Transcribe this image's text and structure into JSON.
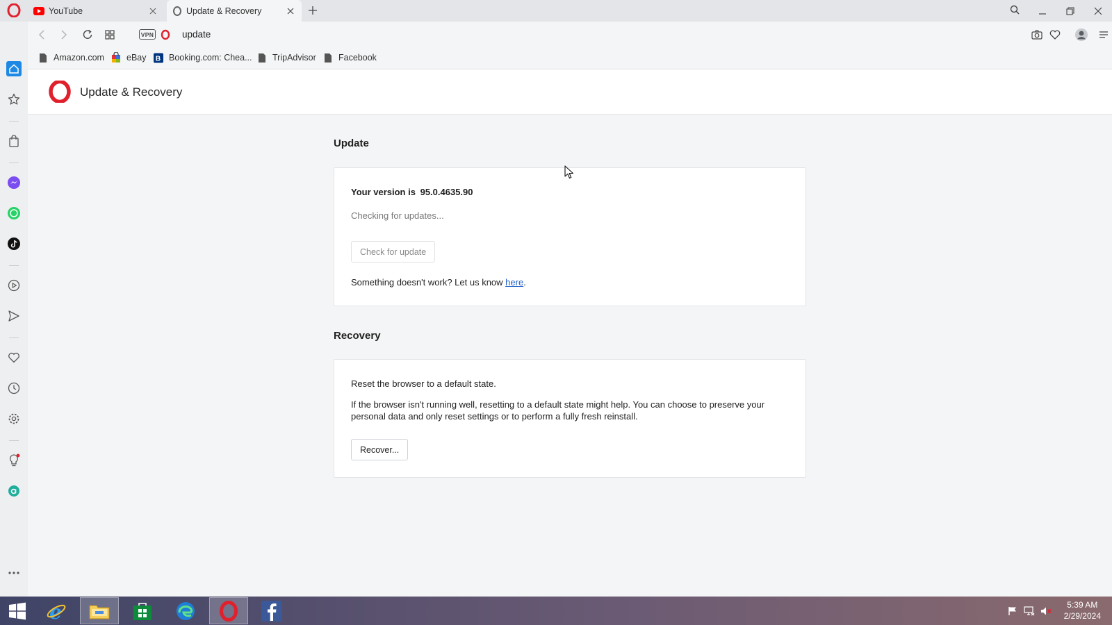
{
  "tabs": [
    {
      "title": "YouTube",
      "icon": "youtube-icon",
      "active": false
    },
    {
      "title": "Update & Recovery",
      "icon": "opera-icon",
      "active": true
    }
  ],
  "toolbar": {
    "vpn_label": "VPN",
    "address": "update"
  },
  "bookmarks": [
    {
      "label": "Amazon.com",
      "icon": "page-icon"
    },
    {
      "label": "eBay",
      "icon": "ebay-bag-icon"
    },
    {
      "label": "Booking.com: Chea...",
      "icon": "booking-icon"
    },
    {
      "label": "TripAdvisor",
      "icon": "page-icon"
    },
    {
      "label": "Facebook",
      "icon": "page-icon"
    }
  ],
  "sidebar": {
    "items": [
      "home-icon",
      "speed-dial-icon",
      "shopping-bag-icon",
      "messenger-icon",
      "whatsapp-icon",
      "tiktok-icon",
      "player-icon",
      "send-icon",
      "heart-icon",
      "history-icon",
      "settings-icon",
      "lightbulb-icon",
      "aria-icon",
      "more-icon"
    ]
  },
  "page": {
    "title": "Update & Recovery"
  },
  "update": {
    "heading": "Update",
    "version_label": "Your version is",
    "version": "95.0.4635.90",
    "status": "Checking for updates...",
    "check_button": "Check for update",
    "feedback_text": "Something doesn't work? Let us know ",
    "feedback_link": "here",
    "feedback_end": "."
  },
  "recovery": {
    "heading": "Recovery",
    "reset_line": "Reset the browser to a default state.",
    "description": "If the browser isn't running well, resetting to a default state might help. You can choose to preserve your personal data and only reset settings or to perform a fully fresh reinstall.",
    "recover_button": "Recover..."
  },
  "taskbar": {
    "apps": [
      "start-icon",
      "internet-explorer-icon",
      "file-explorer-icon",
      "store-icon",
      "edge-icon",
      "opera-icon",
      "facebook-icon"
    ],
    "time": "5:39 AM",
    "date": "2/29/2024"
  },
  "colors": {
    "opera_red": "#e0202c",
    "link_blue": "#2563c9",
    "sidebar_active": "#1e88e5"
  }
}
